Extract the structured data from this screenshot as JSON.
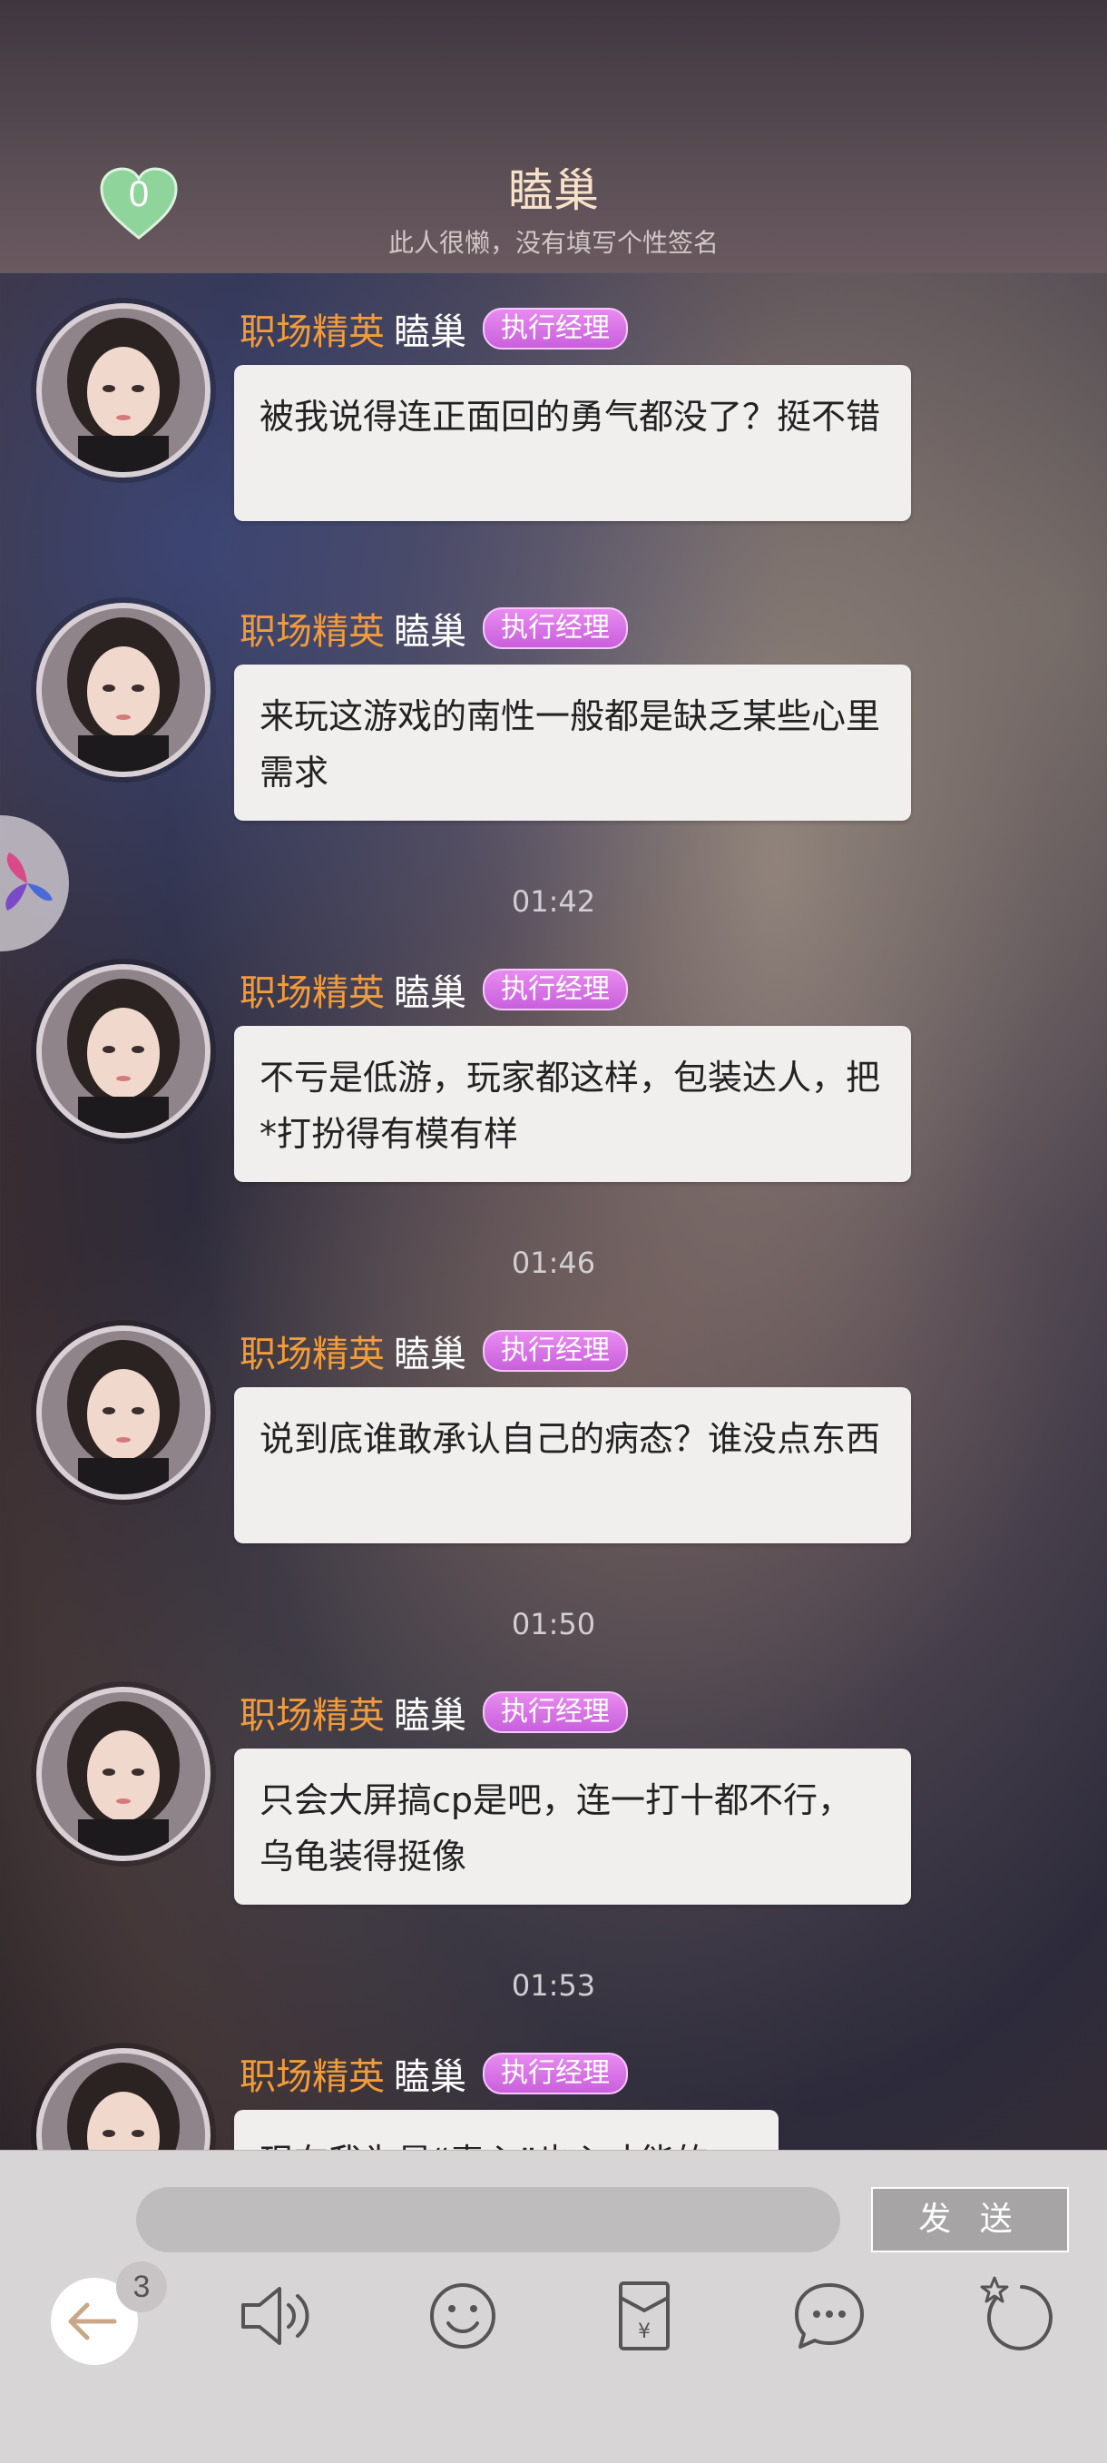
{
  "header": {
    "likes_count": "0",
    "title": "瞌巢",
    "signature": "此人很懒，没有填写个性签名"
  },
  "messages": [
    {
      "role": "职场精英",
      "name": "瞌巢",
      "badge": "执行经理",
      "text": "被我说得连正面回的勇气都没了？挺不错"
    },
    {
      "role": "职场精英",
      "name": "瞌巢",
      "badge": "执行经理",
      "text": "来玩这游戏的南性一般都是缺乏某些心里需求"
    },
    {
      "role": "职场精英",
      "name": "瞌巢",
      "badge": "执行经理",
      "text": "不亏是低游，玩家都这样，包装达人，把*打扮得有模有样"
    },
    {
      "role": "职场精英",
      "name": "瞌巢",
      "badge": "执行经理",
      "text": "说到底谁敢承认自己的病态？谁没点东西"
    },
    {
      "role": "职场精英",
      "name": "瞌巢",
      "badge": "执行经理",
      "text": "只会大屏搞cp是吧，连一打十都不行，乌龟装得挺像"
    },
    {
      "role": "职场精英",
      "name": "瞌巢",
      "badge": "执行经理",
      "text": "现在我为是“毒心”也心才能的"
    }
  ],
  "timestamps": [
    "01:42",
    "01:46",
    "01:50",
    "01:53"
  ],
  "composer": {
    "input_value": "",
    "send_label": "发 送",
    "unread_count": "3"
  },
  "toolbar_icons": [
    "back-arrow-icon",
    "speaker-icon",
    "emoji-icon",
    "red-packet-icon",
    "chat-bubble-icon",
    "star-circle-icon"
  ],
  "colors": {
    "role": "#f29b3a",
    "badge": "#d46ee6",
    "heart": "#8fd49a",
    "title": "#f7e2c8"
  }
}
